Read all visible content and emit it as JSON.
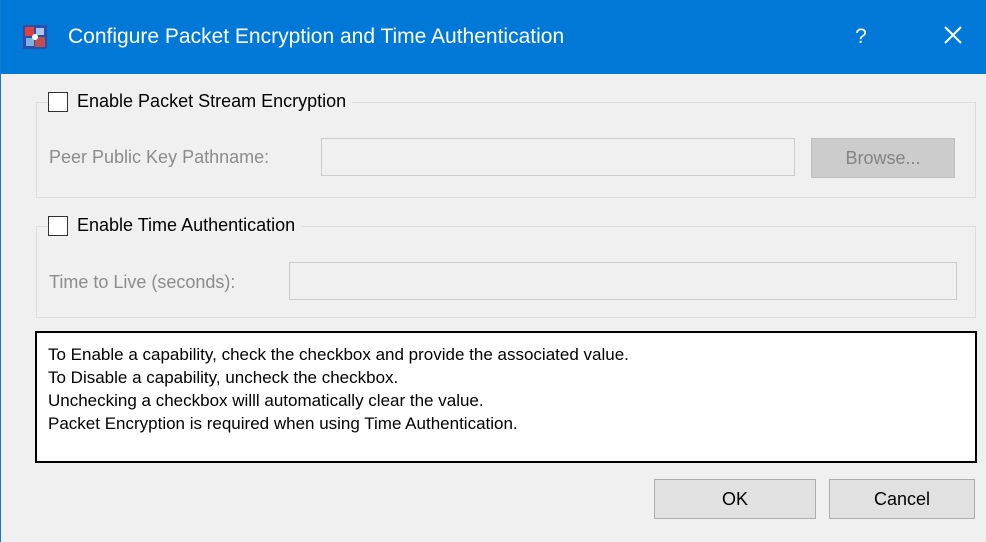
{
  "window": {
    "title": "Configure Packet Encryption and Time Authentication",
    "help_label": "?",
    "app_icon": "network-config-icon",
    "close_icon": "close-icon"
  },
  "encryption": {
    "checkbox_label": "Enable Packet Stream Encryption",
    "checked": false,
    "field_label": "Peer Public Key Pathname:",
    "field_value": "",
    "browse_label": "Browse..."
  },
  "time_auth": {
    "checkbox_label": "Enable Time Authentication",
    "checked": false,
    "field_label": "Time to Live (seconds):",
    "field_value": ""
  },
  "info": {
    "lines": [
      "To Enable a capability, check the checkbox and provide the associated value.",
      "To Disable a capability, uncheck the checkbox.",
      "Unchecking a checkbox willl automatically clear the value.",
      "Packet Encryption is required when using Time Authentication."
    ]
  },
  "buttons": {
    "ok_label": "OK",
    "cancel_label": "Cancel"
  },
  "colors": {
    "titlebar": "#0078d7",
    "window_bg": "#f0f0f0",
    "disabled_text": "#8c8c8c"
  }
}
